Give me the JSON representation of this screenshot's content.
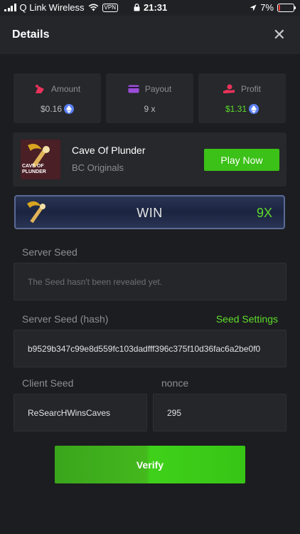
{
  "status_bar": {
    "carrier": "Q Link Wireless",
    "vpn": "VPN",
    "time": "21:31",
    "battery": "7%",
    "battery_level": 0.07
  },
  "header": {
    "title": "Details"
  },
  "stats": {
    "amount": {
      "label": "Amount",
      "value": "$0.16",
      "icon": "money-bag-icon"
    },
    "payout": {
      "label": "Payout",
      "value": "9 x",
      "icon": "credit-card-icon"
    },
    "profit": {
      "label": "Profit",
      "value": "$1.31",
      "icon": "profit-hand-icon"
    }
  },
  "game": {
    "name": "Cave Of Plunder",
    "provider": "BC Originals",
    "play_label": "Play Now",
    "thumb_text": "CAVE OF PLUNDER"
  },
  "result": {
    "text": "WIN",
    "multiplier": "9X"
  },
  "server_seed": {
    "label": "Server Seed",
    "value": "The Seed hasn't been revealed yet."
  },
  "server_seed_hash": {
    "label": "Server Seed (hash)",
    "settings_label": "Seed Settings",
    "value": "b9529b347c99e8d559fc103dadfff396c375f10d36fac6a2be0f0"
  },
  "client_seed": {
    "label": "Client Seed",
    "value": "ReSearcHWinsCaves"
  },
  "nonce": {
    "label": "nonce",
    "value": "295"
  },
  "verify_label": "Verify",
  "colors": {
    "accent": "#3bc117",
    "profit": "#5edd2c",
    "background": "#1c1d20",
    "card": "#26282b",
    "eth": "#5a7ff0"
  }
}
